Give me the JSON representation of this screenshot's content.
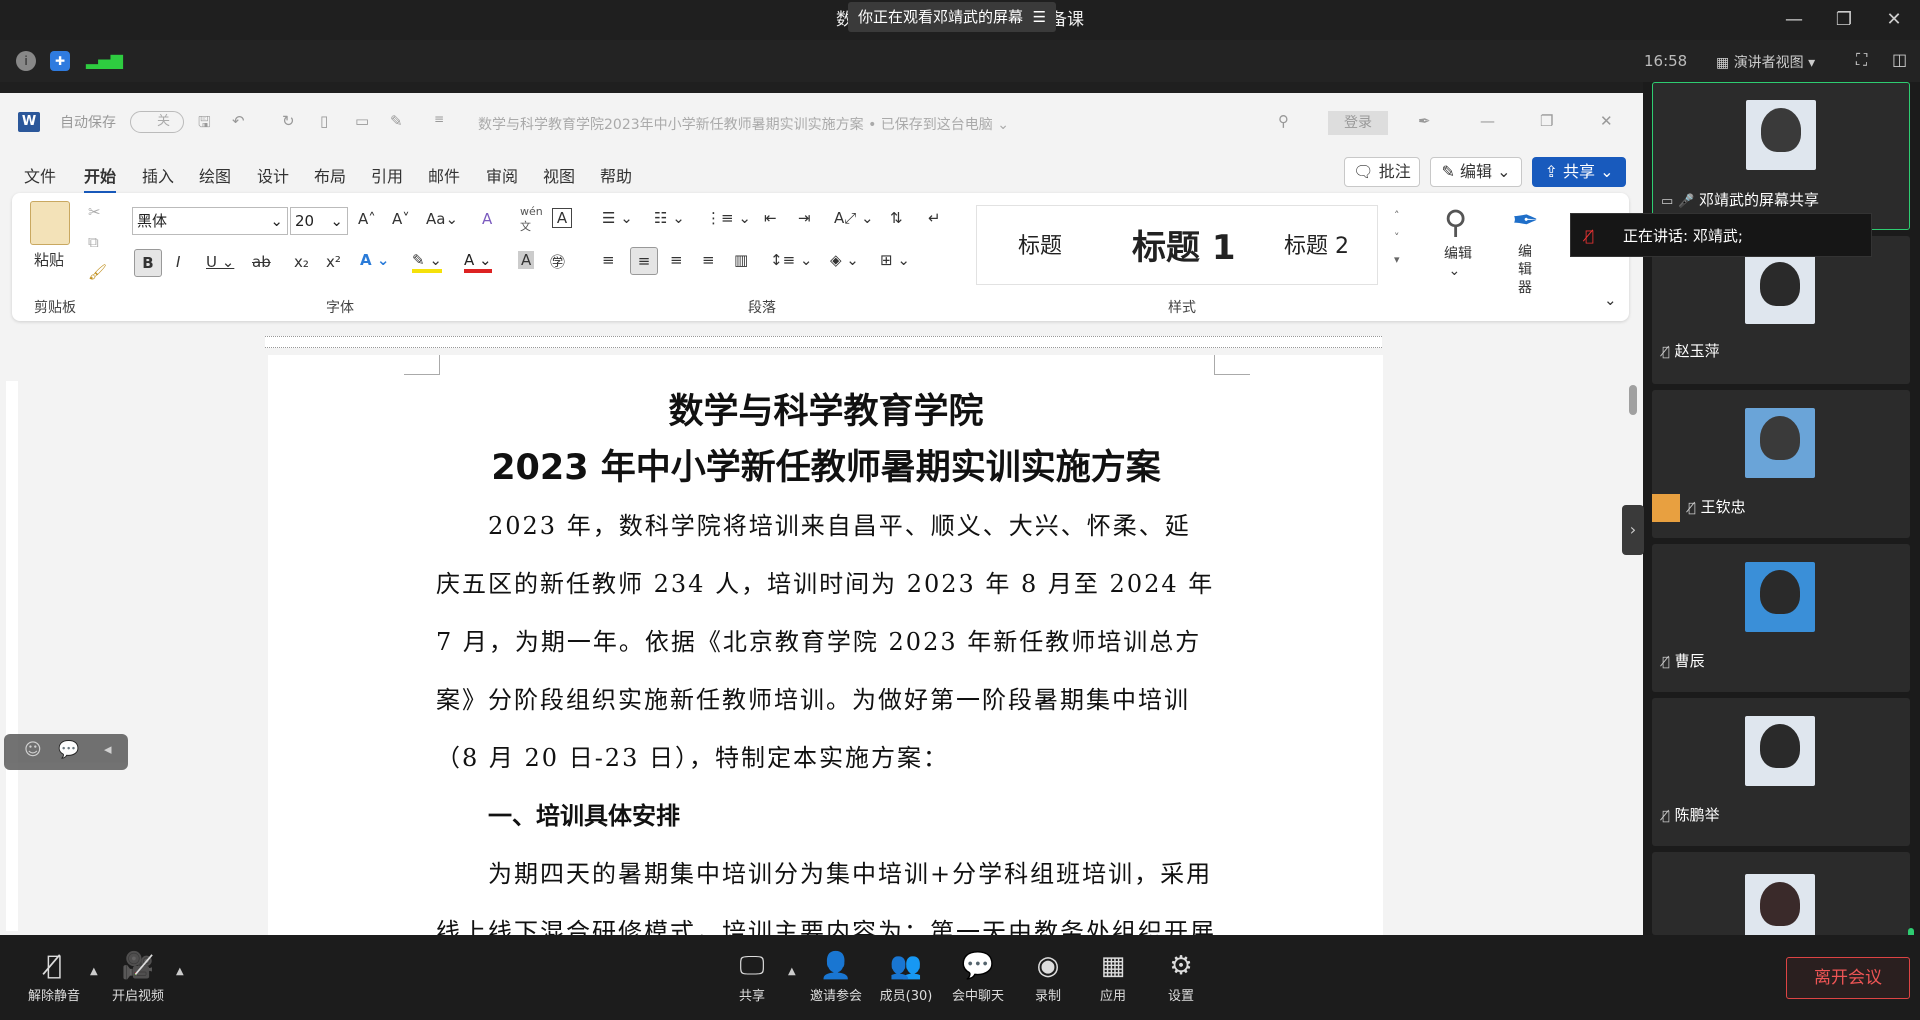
{
  "window": {
    "title_left": "数科",
    "title_right": "备课",
    "share_banner": "你正在观看邓靖武的屏幕",
    "clock": "16:58",
    "view_mode": "演讲者视图"
  },
  "word": {
    "autosave": "自动保存",
    "autosave_state": "关",
    "doc_title": "数学与科学教育学院2023年中小学新任教师暑期实训实施方案 • 已保存到这台电脑",
    "login": "登录",
    "tabs": [
      "文件",
      "开始",
      "插入",
      "绘图",
      "设计",
      "布局",
      "引用",
      "邮件",
      "审阅",
      "视图",
      "帮助"
    ],
    "active_tab": "开始",
    "comment_btn": "批注",
    "edit_btn": "编辑",
    "share_btn": "共享",
    "ribbon": {
      "paste": "粘贴",
      "clipboard": "剪贴板",
      "font_name": "黑体",
      "font_size": "20",
      "font_group": "字体",
      "para_group": "段落",
      "styles_group": "样式",
      "style_1": "标题",
      "style_2": "标题 1",
      "style_3": "标题 2",
      "editing": "编辑",
      "editor": "编辑器"
    },
    "document": {
      "heading_1": "数学与科学教育学院",
      "heading_2": "2023 年中小学新任教师暑期实训实施方案",
      "para_1": "2023 年，数科学院将培训来自昌平、顺义、大兴、怀柔、延庆五区的新任教师  234 人，培训时间为 2023 年 8 月至 2024 年 7 月，为期一年。依据《北京教育学院 2023 年新任教师培训总方案》分阶段组织实施新任教师培训。为做好第一阶段暑期集中培训（8 月 20 日-23 日），特制定本实施方案：",
      "section_1": "一、培训具体安排",
      "para_2": "为期四天的暑期集中培训分为集中培训+分学科组班培训，采用线上线下混合研修模式，培训主要内容为：第一天由教务处组织开展"
    }
  },
  "participants": [
    {
      "name": "邓靖武的屏幕共享"
    },
    {
      "name": "赵玉萍"
    },
    {
      "name": "王钦忠"
    },
    {
      "name": "曹辰"
    },
    {
      "name": "陈鹏举"
    },
    {
      "name": ""
    }
  ],
  "speaking": "正在讲话: 邓靖武;",
  "bottom": {
    "unmute": "解除静音",
    "video": "开启视频",
    "share": "共享",
    "invite": "邀请参会",
    "members": "成员(30)",
    "chat": "会中聊天",
    "record": "录制",
    "apps": "应用",
    "settings": "设置",
    "leave": "离开会议"
  }
}
